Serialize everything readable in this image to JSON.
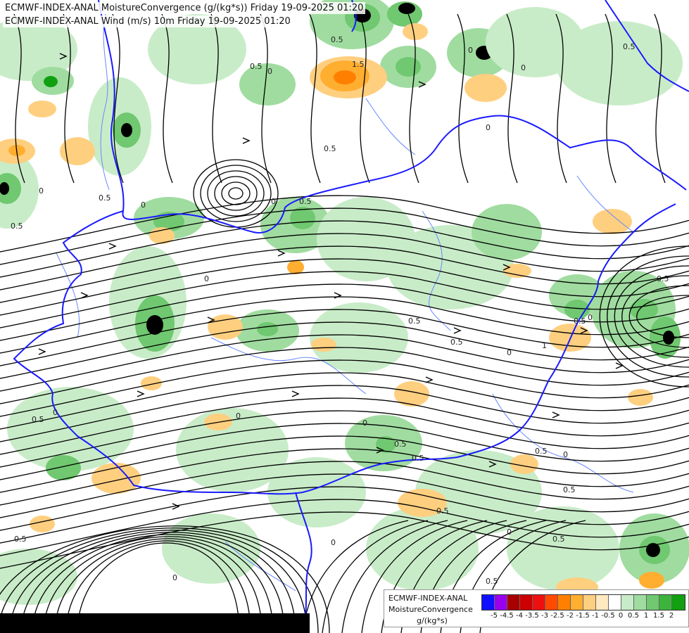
{
  "titles": {
    "line1": "ECMWF-INDEX-ANAL MoistureConvergence (g/(kg*s)) Friday 19-09-2025 01:20",
    "line2": "ECMWF-INDEX-ANAL Wind (m/s) 10m Friday 19-09-2025 01:20"
  },
  "legend": {
    "product": "ECMWF-INDEX-ANAL",
    "parameter": "MoistureConvergence",
    "unit": "g/(kg*s)",
    "swatch_colors": [
      "#1010ff",
      "#9a00ee",
      "#a80000",
      "#cc0000",
      "#ee1010",
      "#ff4a00",
      "#ff8000",
      "#ffae30",
      "#ffcf80",
      "#ffe9c0",
      "#ffffff",
      "#c8ecc8",
      "#a0dca0",
      "#70c870",
      "#3cb43c",
      "#10a010"
    ],
    "tick_labels": [
      "-5",
      "-4.5",
      "-4",
      "-3.5",
      "-3",
      "-2.5",
      "-2",
      "-1.5",
      "-1",
      "-0.5",
      "0",
      "0.5",
      "1",
      "1.5",
      "2"
    ]
  },
  "map": {
    "contour_labels": [
      {
        "text": "0.5"
      },
      {
        "text": "1.5"
      },
      {
        "text": "0.5"
      },
      {
        "text": "0"
      },
      {
        "text": "0"
      },
      {
        "text": "0.5"
      },
      {
        "text": "0"
      },
      {
        "text": "0.5"
      },
      {
        "text": "0"
      },
      {
        "text": "0.5"
      },
      {
        "text": "0.5"
      },
      {
        "text": "0"
      },
      {
        "text": "0.5"
      },
      {
        "text": "0"
      },
      {
        "text": "0.5"
      },
      {
        "text": "0.5"
      },
      {
        "text": "0"
      },
      {
        "text": "0.5"
      },
      {
        "text": "0"
      },
      {
        "text": "0.5"
      },
      {
        "text": "0"
      },
      {
        "text": "0.5"
      },
      {
        "text": "0"
      },
      {
        "text": "0.5"
      },
      {
        "text": "0"
      },
      {
        "text": "0.5"
      },
      {
        "text": "0.5"
      },
      {
        "text": "0"
      },
      {
        "text": "0.5"
      },
      {
        "text": "0.5"
      },
      {
        "text": "1"
      },
      {
        "text": "0"
      },
      {
        "text": "0.5"
      },
      {
        "text": "0.5"
      },
      {
        "text": "0"
      },
      {
        "text": "0"
      },
      {
        "text": "0.5"
      },
      {
        "text": "0"
      },
      {
        "text": "0"
      }
    ],
    "colors": {
      "border": "#1a1aff",
      "river": "#6a88ff",
      "streamline": "#000000",
      "conv_light": "#c8ecc8",
      "conv_mid": "#a0dca0",
      "conv_strong": "#70c870",
      "conv_max": "#10a010",
      "div_light": "#ffcf80",
      "div_mid": "#ffae30",
      "div_strong": "#ff8000",
      "extreme": "#000000"
    }
  }
}
